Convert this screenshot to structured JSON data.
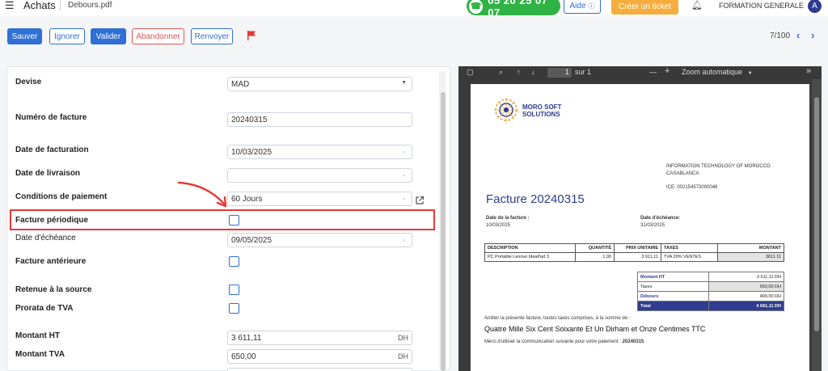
{
  "header": {
    "app_title": "Achats",
    "doc_name": "Debours.pdf",
    "phone": "05 20 25 07 07",
    "help_label": "Aide",
    "ticket_label": "Créer un ticket",
    "company": "FORMATION GENERALE",
    "avatar_initial": "A"
  },
  "toolbar": {
    "save": "Sauver",
    "ignore": "Ignorer",
    "validate": "Valider",
    "abandon": "Abandonner",
    "resend": "Renvoyer",
    "pager": "7/100"
  },
  "form": {
    "currency_label": "Devise",
    "currency_value": "MAD",
    "invoice_number_label": "Numéro de facture",
    "invoice_number_value": "20240315",
    "invoice_date_label": "Date de facturation",
    "invoice_date_value": "10/03/2025",
    "delivery_date_label": "Date de livraison",
    "delivery_date_value": "",
    "payment_terms_label": "Conditions de paiement",
    "payment_terms_value": "60 Jours",
    "periodic_label": "Facture périodique",
    "due_date_label": "Date d'échéance",
    "due_date_value": "09/05/2025",
    "previous_invoice_label": "Facture antérieure",
    "withholding_label": "Retenue à la source",
    "vat_prorata_label": "Prorata de TVA",
    "amount_ht_label": "Montant HT",
    "amount_ht_value": "3 611,11",
    "amount_vat_label": "Montant TVA",
    "amount_vat_value": "650,00",
    "currency_suffix": "DH"
  },
  "pdf": {
    "page_current": "1",
    "page_total": "sur 1",
    "zoom": "Zoom automatique",
    "logo_line1": "MORO SOFT",
    "logo_line2": "SOLUTIONS",
    "vendor_line1": "INFORMATION TECHNOLOGY OF MOROCCO",
    "vendor_line2": "CASABLANCA",
    "vendor_ice": "ICE: 002154573000048",
    "title": "Facture 20240315",
    "invoice_date_label": "Date de la facture :",
    "invoice_date": "10/03/2025",
    "due_date_label": "Date d'échéance:",
    "due_date": "31/03/2025",
    "table_headers": [
      "DESCRIPTION",
      "QUANTITÉ",
      "PRIX UNITAIRE",
      "TAXES",
      "MONTANT"
    ],
    "table_row": [
      "PC Portable Lenovo IdeaPad 3",
      "1,00",
      "3 611,11",
      "TVA 20% VENTES",
      "3611.11"
    ],
    "totals": [
      {
        "label": "Montant HT",
        "value": "3 611,11 DH"
      },
      {
        "label": "Taxes",
        "value": "650,00 DH"
      },
      {
        "label": "Débours",
        "value": "400,00 DH"
      },
      {
        "label": "Total",
        "value": "4 661,11 DH"
      }
    ],
    "stop_text": "Arrêter la présente facture, toutes taxes comprises, à la somme de :",
    "amount_words": "Quatre Mille Six Cent Soixante Et Un Dirham et Onze Centimes TTC",
    "payment_ref_text": "Merci d'utiliser la communication suivante pour votre paiement :",
    "payment_ref": "20240315"
  },
  "colors": {
    "primary": "#2f6fd6",
    "phone_green": "#2fb344",
    "ticket_orange": "#f6ad3d",
    "highlight_red": "#e53935",
    "invoice_blue": "#2f3c8f"
  }
}
